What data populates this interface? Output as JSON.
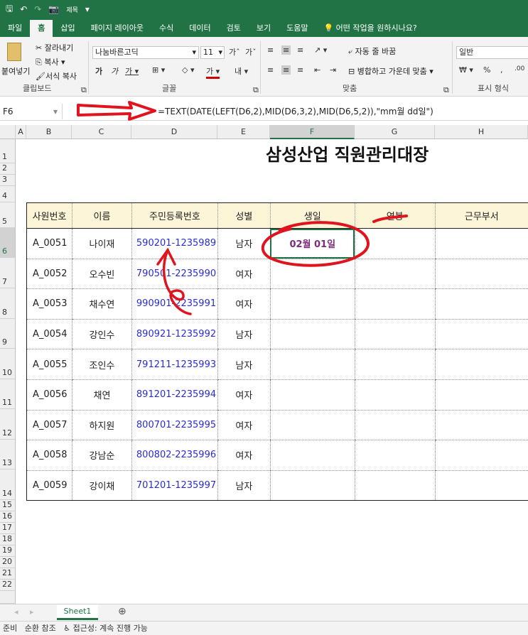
{
  "titlebar": {
    "save_icon": "save-icon",
    "qat_camera": "camera-icon",
    "qat_label": "제목"
  },
  "tabs": [
    "파일",
    "홈",
    "삽입",
    "페이지 레이아웃",
    "수식",
    "데이터",
    "검토",
    "보기",
    "도움말",
    "어떤 작업을 원하시나요?"
  ],
  "active_tab": "홈",
  "ribbon": {
    "paste": "붙여넣기",
    "cut": "잘라내기",
    "copy": "복사",
    "format_painter": "서식 복사",
    "clipboard": "클립보드",
    "font_name": "나눔바른고딕",
    "font_size": "11",
    "font_group": "글꼴",
    "wrap_text": "자동 줄 바꿈",
    "merge_center": "병합하고 가운데 맞춤",
    "align_group": "맞춤",
    "number_format": "일반",
    "number_group": "표시 형식"
  },
  "formula_bar": {
    "cell_ref": "F6",
    "formula": "=TEXT(DATE(LEFT(D6,2),MID(D6,3,2),MID(D6,5,2)),\"mm월 dd일\")"
  },
  "columns": [
    "A",
    "B",
    "C",
    "D",
    "E",
    "F",
    "G",
    "H"
  ],
  "rows": [
    "1",
    "2",
    "3",
    "4",
    "5",
    "6",
    "7",
    "8",
    "9",
    "10",
    "11",
    "12",
    "13",
    "14",
    "15",
    "16",
    "17",
    "18",
    "19",
    "20",
    "21",
    "22"
  ],
  "sheet_title": "삼성산업 직원관리대장",
  "table": {
    "headers": [
      "사원번호",
      "이름",
      "주민등록번호",
      "성별",
      "생일",
      "연봉",
      "근무부서"
    ],
    "rows": [
      [
        "A_0051",
        "나이재",
        "590201-1235989",
        "남자",
        "02월 01일",
        "",
        ""
      ],
      [
        "A_0052",
        "오수빈",
        "790501-2235990",
        "여자",
        "",
        "",
        ""
      ],
      [
        "A_0053",
        "채수연",
        "990901-2235991",
        "여자",
        "",
        "",
        ""
      ],
      [
        "A_0054",
        "강인수",
        "890921-1235992",
        "남자",
        "",
        "",
        ""
      ],
      [
        "A_0055",
        "조인수",
        "791211-1235993",
        "남자",
        "",
        "",
        ""
      ],
      [
        "A_0056",
        "채연",
        "891201-2235994",
        "여자",
        "",
        "",
        ""
      ],
      [
        "A_0057",
        "하지원",
        "800701-2235995",
        "여자",
        "",
        "",
        ""
      ],
      [
        "A_0058",
        "강남순",
        "800802-2235996",
        "여자",
        "",
        "",
        ""
      ],
      [
        "A_0059",
        "강이채",
        "701201-1235997",
        "남자",
        "",
        "",
        ""
      ]
    ]
  },
  "sheet_tab": "Sheet1",
  "status": {
    "ready": "준비",
    "circular": "순환 참조",
    "accessibility": "접근성: 계속 진행 가능"
  },
  "colors": {
    "excel_green": "#217346",
    "annotation_red": "#e0141e",
    "header_fill": "#fdf5d8",
    "jumin_blue": "#2b2bd6"
  }
}
